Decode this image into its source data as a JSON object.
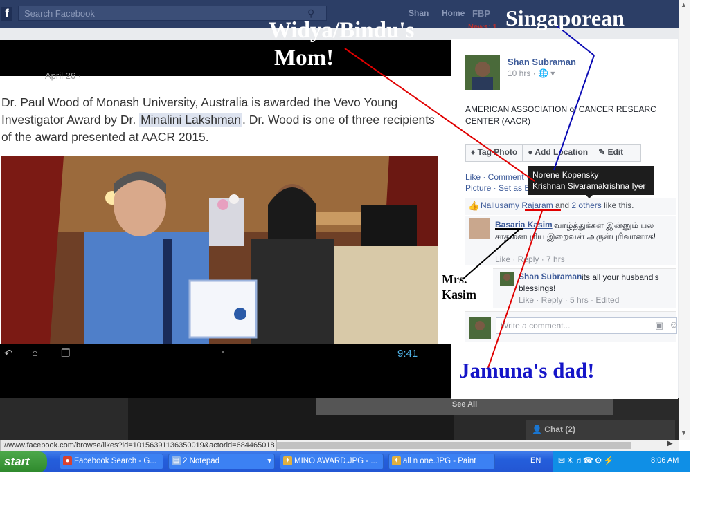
{
  "fb": {
    "search_placeholder": "Search Facebook",
    "user_name": "Shan",
    "home_label": "Home",
    "page_short": "FBP",
    "news_badge": "News: 1"
  },
  "viewer": {
    "date_ghost": "April 26 · ",
    "caption_part1": "Dr. Paul Wood of Monash University, Australia is awarded the Vevo Young Investigator Award by Dr. ",
    "caption_highlight": "Minalini Lakshman",
    "caption_part2": ". Dr. Wood is one of three recipients of the award presented at AACR 2015.",
    "android_time": "9:41"
  },
  "post": {
    "author": "Shan Subraman",
    "meta": "10 hrs · 🌐 ▾",
    "text": "AMERICAN ASSOCIATION of CANCER RESEARC CENTER (AACR)",
    "actions": [
      "Tag Photo",
      "Add Location",
      "Edit"
    ],
    "actions_line": "Like · Comment · Share · Download · Make Profile Picture · Set as Background",
    "tooltip_line1": "Norene Kopensky",
    "tooltip_line2": "Krishnan Sivaramakrishna Iyer",
    "likes_name_a": "Nallusamy",
    "likes_name_b": "Rajaram",
    "likes_and": " and ",
    "likes_others": "2 others",
    "likes_suffix": " like this."
  },
  "comments": [
    {
      "name": "Basaria Kasim",
      "text": "வாழ்த்துக்கள் இன்னும் பல சாதனைபுரிய இறைவன் அருள்புரிவானாக!",
      "meta": "Like · Reply · 7 hrs"
    },
    {
      "name": "Shan Subraman",
      "text": "its all your husband's blessings!",
      "meta": "Like · Reply · 5 hrs · Edited"
    }
  ],
  "comment_placeholder": "Write a comment...",
  "background_ui": {
    "see_all": "See All",
    "chat": "Chat (2)"
  },
  "annotations": {
    "widya_line1": "Widya/Bindu's",
    "widya_line2": "Mom!",
    "singaporean": "Singaporean",
    "kasim_line1": "Mrs.",
    "kasim_line2": "Kasim",
    "jamuna": "Jamuna's dad!",
    "colors": {
      "widya_line": "#e00000",
      "singaporean_line": "#0a0ab4",
      "kasim_line": "#000000",
      "jamuna_line": "#e00000",
      "jamuna_text": "#1515c8"
    }
  },
  "browser": {
    "status_url": "://www.facebook.com/browse/likes?id=10156391136350019&actorid=684465018"
  },
  "taskbar": {
    "start": "start",
    "tasks": [
      {
        "label": "Facebook Search - G...",
        "icon": "chrome-icon"
      },
      {
        "label": "2 Notepad",
        "icon": "notepad-icon"
      },
      {
        "label": "MINO AWARD.JPG - ...",
        "icon": "paint-icon"
      },
      {
        "label": "all n one.JPG - Paint",
        "icon": "paint-icon"
      }
    ],
    "lang": "EN",
    "clock": "8:06 AM"
  }
}
